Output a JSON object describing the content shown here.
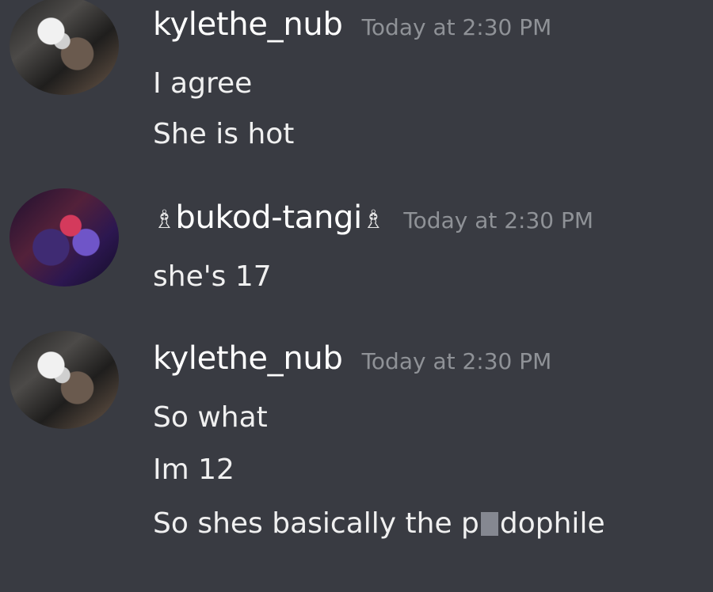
{
  "messages": [
    {
      "username": "kylethe_nub",
      "timestamp": "Today at 2:30 PM",
      "lines": [
        "I agree",
        "She is hot"
      ]
    },
    {
      "username_deco_left": "♗",
      "username": "bukod-tangi",
      "username_deco_right": "♗",
      "timestamp": "Today at 2:30 PM",
      "lines": [
        "she's 17"
      ]
    },
    {
      "username": "kylethe_nub",
      "timestamp": "Today at 2:30 PM",
      "lines": [
        "So what",
        "Im 12"
      ],
      "last_line_prefix": "So shes basically the p",
      "last_line_suffix": "dophile"
    }
  ]
}
